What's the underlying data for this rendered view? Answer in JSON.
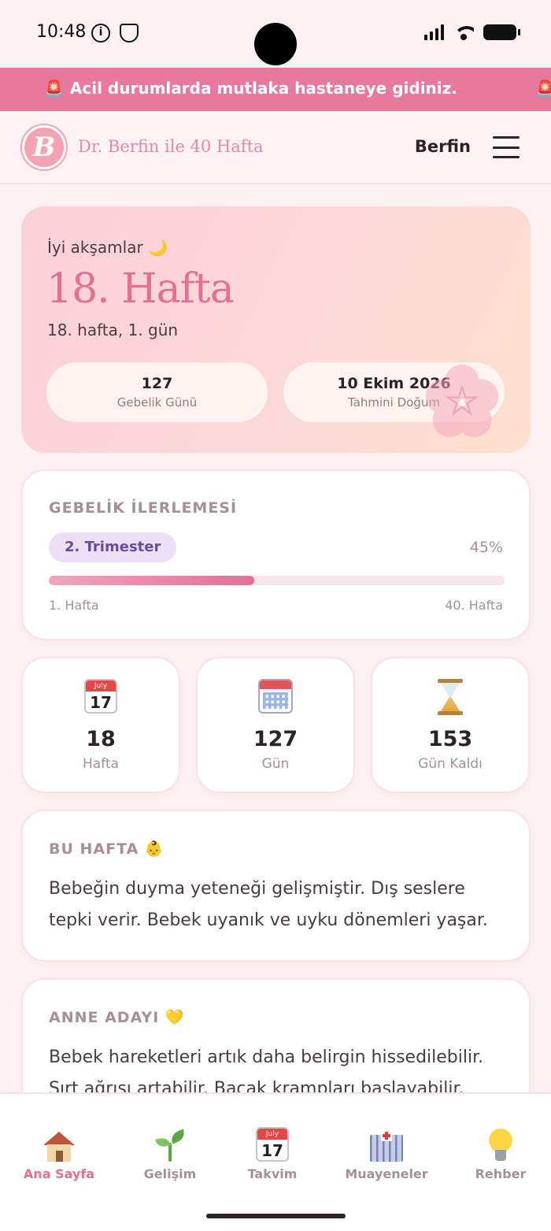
{
  "status_bar": {
    "time": "10:48",
    "icons": [
      "info-icon",
      "shield-icon",
      "signal-icon",
      "wifi-icon",
      "battery-icon"
    ]
  },
  "alert": {
    "icon": "siren-icon",
    "text": "Acil durumlarda mutlaka hastaneye gidiniz."
  },
  "header": {
    "logo_letter": "B",
    "title": "Dr. Berfin ile 40 Hafta",
    "user_name": "Berfin",
    "menu_icon": "hamburger-menu-icon"
  },
  "hero": {
    "greeting": "İyi akşamlar 🌙",
    "week_title": "18. Hafta",
    "subtitle": "18. hafta, 1. gün",
    "pregnancy_day_value": "127",
    "pregnancy_day_label": "Gebelik Günü",
    "due_date_value": "10 Ekim 2026",
    "due_date_label": "Tahmini Doğum"
  },
  "progress": {
    "title": "GEBELİK İLERLEMESİ",
    "trimester": "2. Trimester",
    "percent_label": "45%",
    "percent_value": 45,
    "start_label": "1. Hafta",
    "end_label": "40. Hafta"
  },
  "stats": [
    {
      "icon": "calendar-icon",
      "icon_month": "July",
      "icon_day": "17",
      "value": "18",
      "label": "Hafta"
    },
    {
      "icon": "spiral-calendar-icon",
      "value": "127",
      "label": "Gün"
    },
    {
      "icon": "hourglass-icon",
      "value": "153",
      "label": "Gün Kaldı"
    }
  ],
  "this_week": {
    "title": "BU HAFTA 👶",
    "text": "Bebeğin duyma yeteneği gelişmiştir. Dış seslere tepki verir. Bebek uyanık ve uyku dönemleri yaşar."
  },
  "mother": {
    "title": "ANNE ADAYI 💛",
    "text": "Bebek hareketleri artık daha belirgin hissedilebilir. Sırt ağrısı artabilir. Bacak krampları başlayabilir."
  },
  "nav": [
    {
      "label": "Ana Sayfa",
      "icon": "home-icon",
      "active": true
    },
    {
      "label": "Gelişim",
      "icon": "sprout-icon",
      "active": false
    },
    {
      "label": "Takvim",
      "icon": "calendar-icon",
      "icon_month": "July",
      "icon_day": "17",
      "active": false
    },
    {
      "label": "Muayeneler",
      "icon": "hospital-icon",
      "active": false
    },
    {
      "label": "Rehber",
      "icon": "lightbulb-icon",
      "active": false
    }
  ],
  "colors": {
    "accent": "#e46f93",
    "banner": "#e8789c",
    "background": "#fdf1f3",
    "trimester_badge": "#ebe0f6"
  }
}
